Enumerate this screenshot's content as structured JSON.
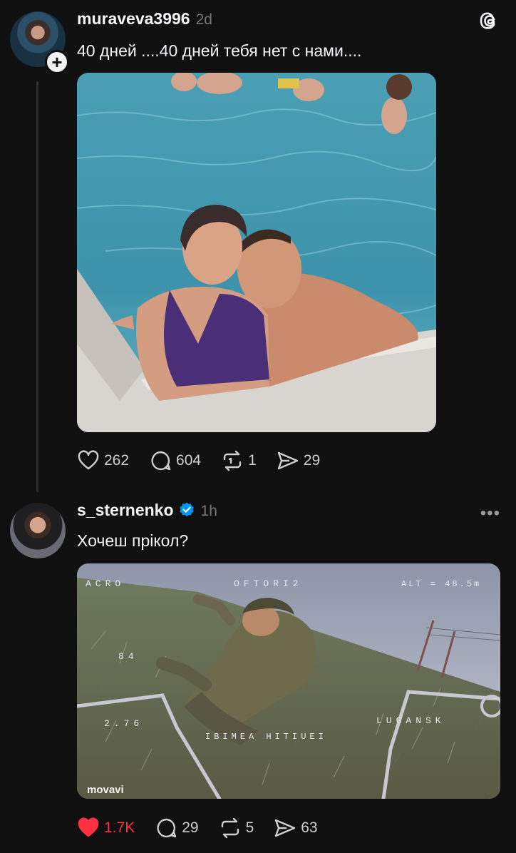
{
  "post1": {
    "username": "muraveva3996",
    "time": "2d",
    "caption": "40 дней ....40 дней тебя нет с нами....",
    "likes": "262",
    "comments": "604",
    "reposts": "1",
    "shares": "29"
  },
  "post2": {
    "username": "s_sternenko",
    "time": "1h",
    "caption": "Хочеш прікол?",
    "likes": "1.7K",
    "comments": "29",
    "reposts": "5",
    "shares": "63",
    "liked": true,
    "video_overlay": {
      "mode": "ACRO",
      "center": "OFTORI2",
      "alt": "ALT = 48.5m",
      "left_value": "84",
      "left_value_2": "2.76",
      "bottom_text": "IBIMEA HITIUEI",
      "location": "LUGANSK",
      "watermark": "movavi"
    }
  },
  "colors": {
    "background": "#101010",
    "text": "#f3f5f7",
    "muted": "#777777",
    "like": "#ff3040",
    "verified": "#0095f6"
  },
  "icons": [
    "threads-logo-icon",
    "plus-icon",
    "heart-icon",
    "comment-icon",
    "repost-icon",
    "share-icon",
    "verified-icon",
    "more-icon"
  ]
}
